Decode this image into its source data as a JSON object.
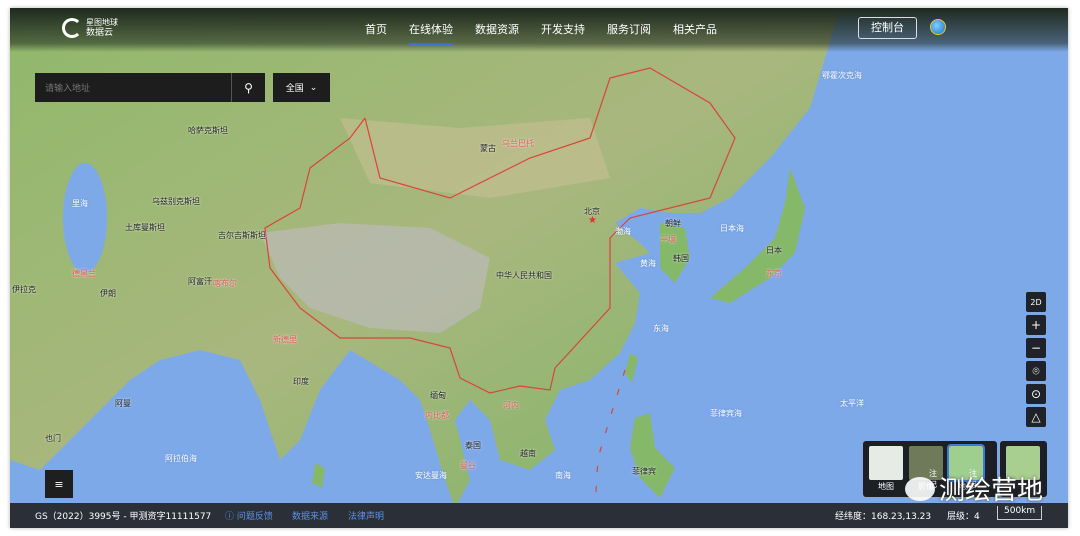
{
  "header": {
    "logo_line1": "星图地球",
    "logo_line2": "数据云",
    "nav": [
      "首页",
      "在线体验",
      "数据资源",
      "开发支持",
      "服务订阅",
      "相关产品"
    ],
    "active_nav": "在线体验",
    "console": "控制台"
  },
  "search": {
    "placeholder": "请输入地址",
    "region": "全国"
  },
  "map_labels": {
    "kazakhstan": "哈萨克斯坦",
    "uzbekistan": "乌兹别克斯坦",
    "turkmenistan": "土库曼斯坦",
    "kyrgyzstan": "吉尔吉斯斯坦",
    "afghanistan": "阿富汗",
    "kabul": "喀布尔",
    "iran": "伊朗",
    "tehran": "德黑兰",
    "iraq": "伊拉克",
    "caspian": "里海",
    "mongolia": "蒙古",
    "ulaanbaatar": "乌兰巴托",
    "beijing": "北京",
    "china": "中华人民共和国",
    "bohai": "渤海",
    "yellow_sea": "黄海",
    "north_korea": "朝鲜",
    "pyongyang": "平壤",
    "south_korea": "韩国",
    "japan_sea": "日本海",
    "japan": "日本",
    "tokyo": "东京",
    "india": "印度",
    "new_delhi": "新德里",
    "myanmar": "缅甸",
    "naypyidaw": "内比都",
    "hanoi": "河内",
    "thailand": "泰国",
    "bangkok": "曼谷",
    "vietnam": "越南",
    "south_china_sea": "南海",
    "philippines": "菲律宾",
    "philippine_sea": "菲律宾海",
    "pacific": "太平洋",
    "andaman": "安达曼海",
    "okhotsk": "鄂霍次克海",
    "east_china_sea": "东海",
    "arabian_sea": "阿拉伯海",
    "oman": "阿曼",
    "yemen": "也门"
  },
  "controls": {
    "mode": "2D"
  },
  "layers": {
    "items": [
      "地图",
      "影像",
      "地形"
    ],
    "annotation": "注记"
  },
  "footer": {
    "license": "GS（2022）3995号 - 甲测资字11111577",
    "feedback": "问题反馈",
    "source": "数据来源",
    "legal": "法律声明",
    "coords_label": "经纬度：",
    "coords": "168.23,13.23",
    "level_label": "层级：",
    "level": "4",
    "scale": "500km"
  },
  "watermark": "测绘营地"
}
